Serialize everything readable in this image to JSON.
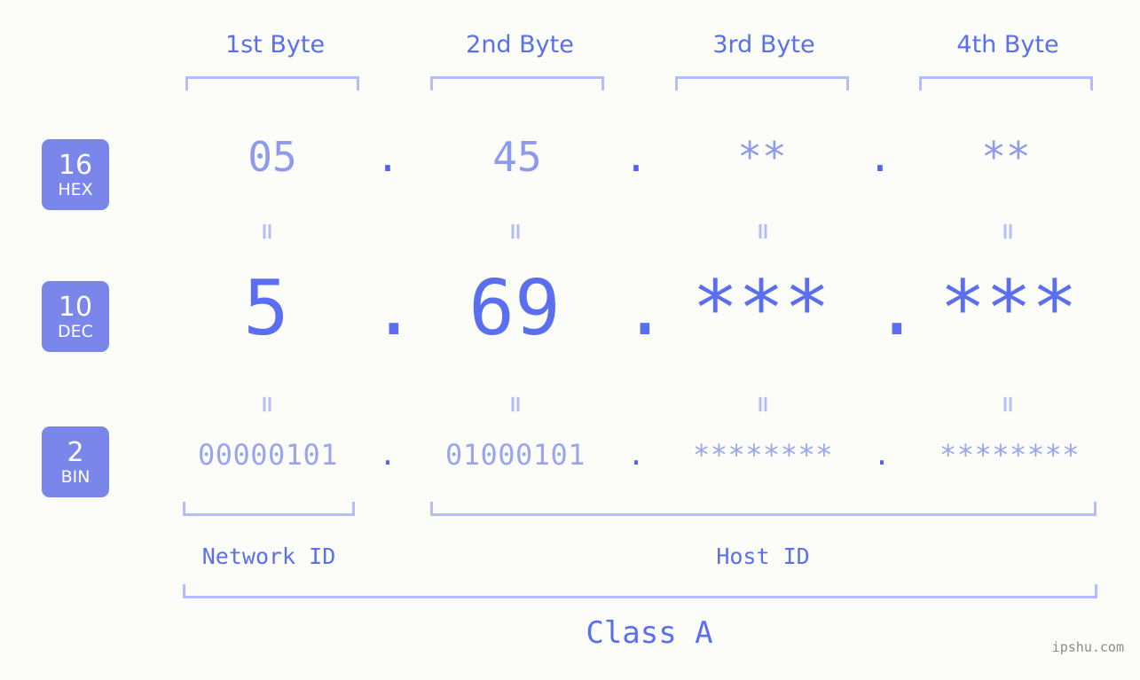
{
  "meta": {
    "background_color": "#fcfdf8",
    "accent_color": "#5a6ff0",
    "light_accent_color": "#b3bdfb",
    "badge_color": "#7b86ea",
    "watermark": "ipshu.com"
  },
  "headers": [
    {
      "label": "1st Byte"
    },
    {
      "label": "2nd Byte"
    },
    {
      "label": "3rd Byte"
    },
    {
      "label": "4th Byte"
    }
  ],
  "bases": [
    {
      "number": "16",
      "name": "HEX"
    },
    {
      "number": "10",
      "name": "DEC"
    },
    {
      "number": "2",
      "name": "BIN"
    }
  ],
  "separator": ".",
  "equals_mark": "=",
  "rows": {
    "hex": {
      "values": [
        "05",
        "45",
        "**",
        "**"
      ]
    },
    "dec": {
      "values": [
        "5",
        "69",
        "***",
        "***"
      ]
    },
    "bin": {
      "values": [
        "00000101",
        "01000101",
        "********",
        "********"
      ]
    }
  },
  "segments": {
    "network_id": "Network ID",
    "host_id": "Host ID",
    "class": "Class A"
  }
}
